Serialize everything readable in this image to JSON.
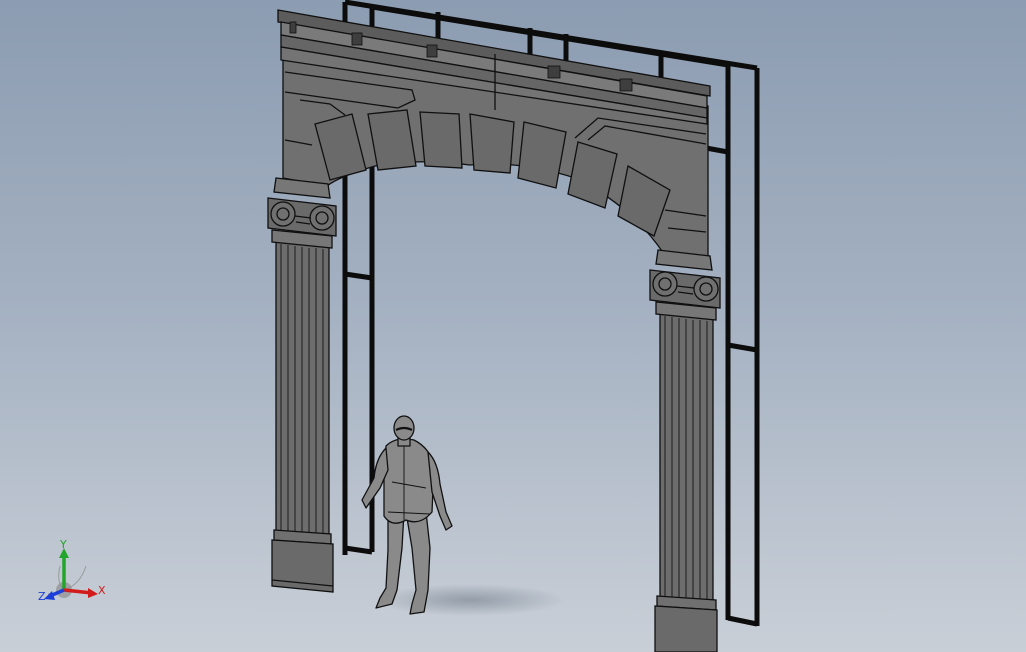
{
  "viewport": {
    "background_top": "#8c9cb1",
    "background_bottom": "#c9cfd7"
  },
  "model": {
    "stone_color": "#6f6f6f",
    "stone_light": "#7c7c7c",
    "edge_color": "#101010",
    "frame_color": "#0c0c0c",
    "figure_color": "#8a8a8a"
  },
  "triad": {
    "icon": "coordinate-triad-icon",
    "x_label": "X",
    "y_label": "Y",
    "z_label": "Z",
    "x_color": "#d21b1b",
    "y_color": "#22a52a",
    "z_color": "#1b3fd8"
  }
}
